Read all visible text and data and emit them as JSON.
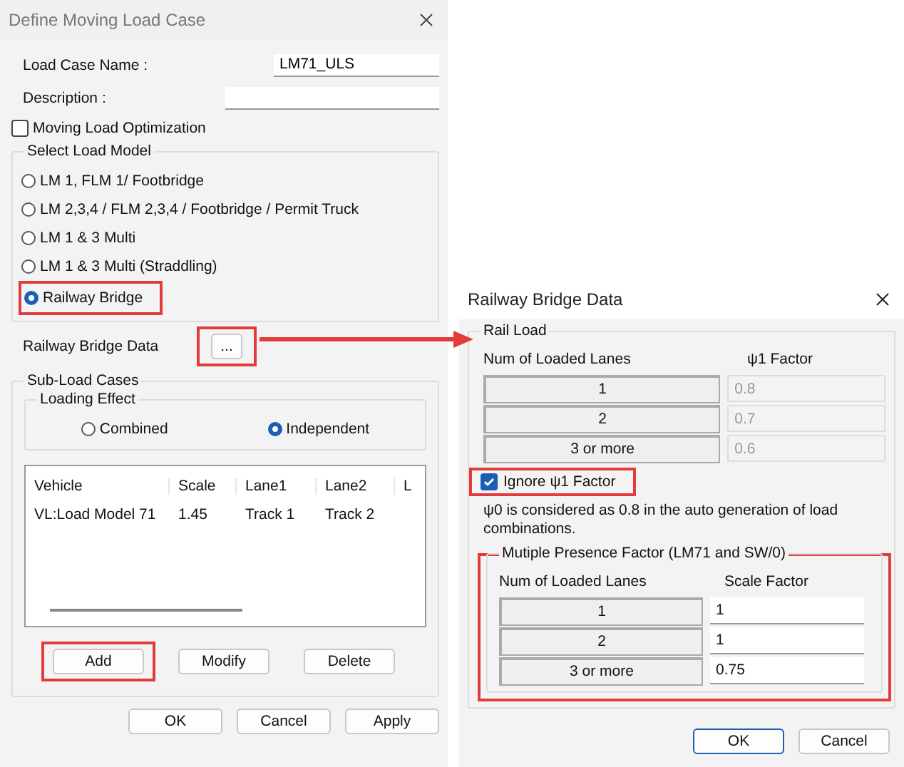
{
  "main_dialog": {
    "title": "Define Moving Load Case",
    "load_case_name": {
      "label": "Load Case Name  :",
      "value": "LM71_ULS"
    },
    "description": {
      "label": "Description :"
    },
    "optimization": {
      "label": "Moving Load Optimization",
      "checked": false
    },
    "load_model": {
      "title": "Select Load Model",
      "options": [
        {
          "label": "LM 1, FLM 1/ Footbridge",
          "selected": false,
          "highlighted": false
        },
        {
          "label": "LM 2,3,4 / FLM 2,3,4 / Footbridge / Permit Truck",
          "selected": false,
          "highlighted": false
        },
        {
          "label": "LM 1 & 3 Multi",
          "selected": false,
          "highlighted": false
        },
        {
          "label": "LM 1 & 3 Multi (Straddling)",
          "selected": false,
          "highlighted": false
        },
        {
          "label": "Railway Bridge",
          "selected": true,
          "highlighted": true
        }
      ]
    },
    "railway_data": {
      "label": "Railway Bridge Data",
      "button": "...",
      "highlighted": true
    },
    "sub_load_cases": {
      "title": "Sub-Load Cases",
      "loading_effect": {
        "title": "Loading Effect",
        "options": [
          {
            "label": "Combined",
            "selected": false
          },
          {
            "label": "Independent",
            "selected": true
          }
        ]
      },
      "table": {
        "columns": [
          "Vehicle",
          "Scale",
          "Lane1",
          "Lane2",
          "L"
        ],
        "rows": [
          [
            "VL:Load Model 71",
            "1.45",
            "Track 1",
            "Track 2"
          ]
        ]
      },
      "buttons": [
        {
          "label": "Add",
          "highlighted": true
        },
        {
          "label": "Modify",
          "highlighted": false
        },
        {
          "label": "Delete",
          "highlighted": false
        }
      ]
    },
    "buttons": [
      "OK",
      "Cancel",
      "Apply"
    ]
  },
  "railway_dialog": {
    "title": "Railway Bridge Data",
    "rail_load": {
      "title": "Rail Load",
      "columns": [
        "Num of Loaded Lanes",
        "ψ1 Factor"
      ],
      "disabled": true,
      "rows": [
        {
          "lanes": "1",
          "factor": "0.8"
        },
        {
          "lanes": "2",
          "factor": "0.7"
        },
        {
          "lanes": "3 or more",
          "factor": "0.6"
        }
      ]
    },
    "ignore": {
      "label": "Ignore ψ1 Factor",
      "checked": true,
      "highlighted": true
    },
    "note": "ψ0 is considered as 0.8 in the auto generation of load combinations.",
    "presence": {
      "title": "Mutiple Presence Factor (LM71 and SW/0)",
      "columns": [
        "Num of Loaded Lanes",
        "Scale Factor"
      ],
      "highlighted": true,
      "rows": [
        {
          "lanes": "1",
          "factor": "1"
        },
        {
          "lanes": "2",
          "factor": "1"
        },
        {
          "lanes": "3 or more",
          "factor": "0.75"
        }
      ]
    },
    "buttons": [
      {
        "label": "OK",
        "default": true
      },
      {
        "label": "Cancel",
        "default": false
      }
    ]
  }
}
